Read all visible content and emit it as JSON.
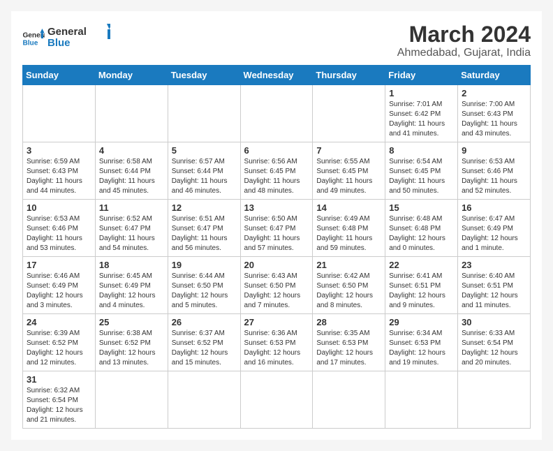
{
  "logo": {
    "text_general": "General",
    "text_blue": "Blue"
  },
  "title": "March 2024",
  "subtitle": "Ahmedabad, Gujarat, India",
  "weekdays": [
    "Sunday",
    "Monday",
    "Tuesday",
    "Wednesday",
    "Thursday",
    "Friday",
    "Saturday"
  ],
  "days": [
    {
      "date": "",
      "info": ""
    },
    {
      "date": "",
      "info": ""
    },
    {
      "date": "",
      "info": ""
    },
    {
      "date": "",
      "info": ""
    },
    {
      "date": "",
      "info": ""
    },
    {
      "date": "1",
      "info": "Sunrise: 7:01 AM\nSunset: 6:42 PM\nDaylight: 11 hours\nand 41 minutes."
    },
    {
      "date": "2",
      "info": "Sunrise: 7:00 AM\nSunset: 6:43 PM\nDaylight: 11 hours\nand 43 minutes."
    },
    {
      "date": "3",
      "info": "Sunrise: 6:59 AM\nSunset: 6:43 PM\nDaylight: 11 hours\nand 44 minutes."
    },
    {
      "date": "4",
      "info": "Sunrise: 6:58 AM\nSunset: 6:44 PM\nDaylight: 11 hours\nand 45 minutes."
    },
    {
      "date": "5",
      "info": "Sunrise: 6:57 AM\nSunset: 6:44 PM\nDaylight: 11 hours\nand 46 minutes."
    },
    {
      "date": "6",
      "info": "Sunrise: 6:56 AM\nSunset: 6:45 PM\nDaylight: 11 hours\nand 48 minutes."
    },
    {
      "date": "7",
      "info": "Sunrise: 6:55 AM\nSunset: 6:45 PM\nDaylight: 11 hours\nand 49 minutes."
    },
    {
      "date": "8",
      "info": "Sunrise: 6:54 AM\nSunset: 6:45 PM\nDaylight: 11 hours\nand 50 minutes."
    },
    {
      "date": "9",
      "info": "Sunrise: 6:53 AM\nSunset: 6:46 PM\nDaylight: 11 hours\nand 52 minutes."
    },
    {
      "date": "10",
      "info": "Sunrise: 6:53 AM\nSunset: 6:46 PM\nDaylight: 11 hours\nand 53 minutes."
    },
    {
      "date": "11",
      "info": "Sunrise: 6:52 AM\nSunset: 6:47 PM\nDaylight: 11 hours\nand 54 minutes."
    },
    {
      "date": "12",
      "info": "Sunrise: 6:51 AM\nSunset: 6:47 PM\nDaylight: 11 hours\nand 56 minutes."
    },
    {
      "date": "13",
      "info": "Sunrise: 6:50 AM\nSunset: 6:47 PM\nDaylight: 11 hours\nand 57 minutes."
    },
    {
      "date": "14",
      "info": "Sunrise: 6:49 AM\nSunset: 6:48 PM\nDaylight: 11 hours\nand 59 minutes."
    },
    {
      "date": "15",
      "info": "Sunrise: 6:48 AM\nSunset: 6:48 PM\nDaylight: 12 hours\nand 0 minutes."
    },
    {
      "date": "16",
      "info": "Sunrise: 6:47 AM\nSunset: 6:49 PM\nDaylight: 12 hours\nand 1 minute."
    },
    {
      "date": "17",
      "info": "Sunrise: 6:46 AM\nSunset: 6:49 PM\nDaylight: 12 hours\nand 3 minutes."
    },
    {
      "date": "18",
      "info": "Sunrise: 6:45 AM\nSunset: 6:49 PM\nDaylight: 12 hours\nand 4 minutes."
    },
    {
      "date": "19",
      "info": "Sunrise: 6:44 AM\nSunset: 6:50 PM\nDaylight: 12 hours\nand 5 minutes."
    },
    {
      "date": "20",
      "info": "Sunrise: 6:43 AM\nSunset: 6:50 PM\nDaylight: 12 hours\nand 7 minutes."
    },
    {
      "date": "21",
      "info": "Sunrise: 6:42 AM\nSunset: 6:50 PM\nDaylight: 12 hours\nand 8 minutes."
    },
    {
      "date": "22",
      "info": "Sunrise: 6:41 AM\nSunset: 6:51 PM\nDaylight: 12 hours\nand 9 minutes."
    },
    {
      "date": "23",
      "info": "Sunrise: 6:40 AM\nSunset: 6:51 PM\nDaylight: 12 hours\nand 11 minutes."
    },
    {
      "date": "24",
      "info": "Sunrise: 6:39 AM\nSunset: 6:52 PM\nDaylight: 12 hours\nand 12 minutes."
    },
    {
      "date": "25",
      "info": "Sunrise: 6:38 AM\nSunset: 6:52 PM\nDaylight: 12 hours\nand 13 minutes."
    },
    {
      "date": "26",
      "info": "Sunrise: 6:37 AM\nSunset: 6:52 PM\nDaylight: 12 hours\nand 15 minutes."
    },
    {
      "date": "27",
      "info": "Sunrise: 6:36 AM\nSunset: 6:53 PM\nDaylight: 12 hours\nand 16 minutes."
    },
    {
      "date": "28",
      "info": "Sunrise: 6:35 AM\nSunset: 6:53 PM\nDaylight: 12 hours\nand 17 minutes."
    },
    {
      "date": "29",
      "info": "Sunrise: 6:34 AM\nSunset: 6:53 PM\nDaylight: 12 hours\nand 19 minutes."
    },
    {
      "date": "30",
      "info": "Sunrise: 6:33 AM\nSunset: 6:54 PM\nDaylight: 12 hours\nand 20 minutes."
    },
    {
      "date": "31",
      "info": "Sunrise: 6:32 AM\nSunset: 6:54 PM\nDaylight: 12 hours\nand 21 minutes."
    },
    {
      "date": "",
      "info": ""
    },
    {
      "date": "",
      "info": ""
    },
    {
      "date": "",
      "info": ""
    },
    {
      "date": "",
      "info": ""
    },
    {
      "date": "",
      "info": ""
    },
    {
      "date": "",
      "info": ""
    }
  ]
}
